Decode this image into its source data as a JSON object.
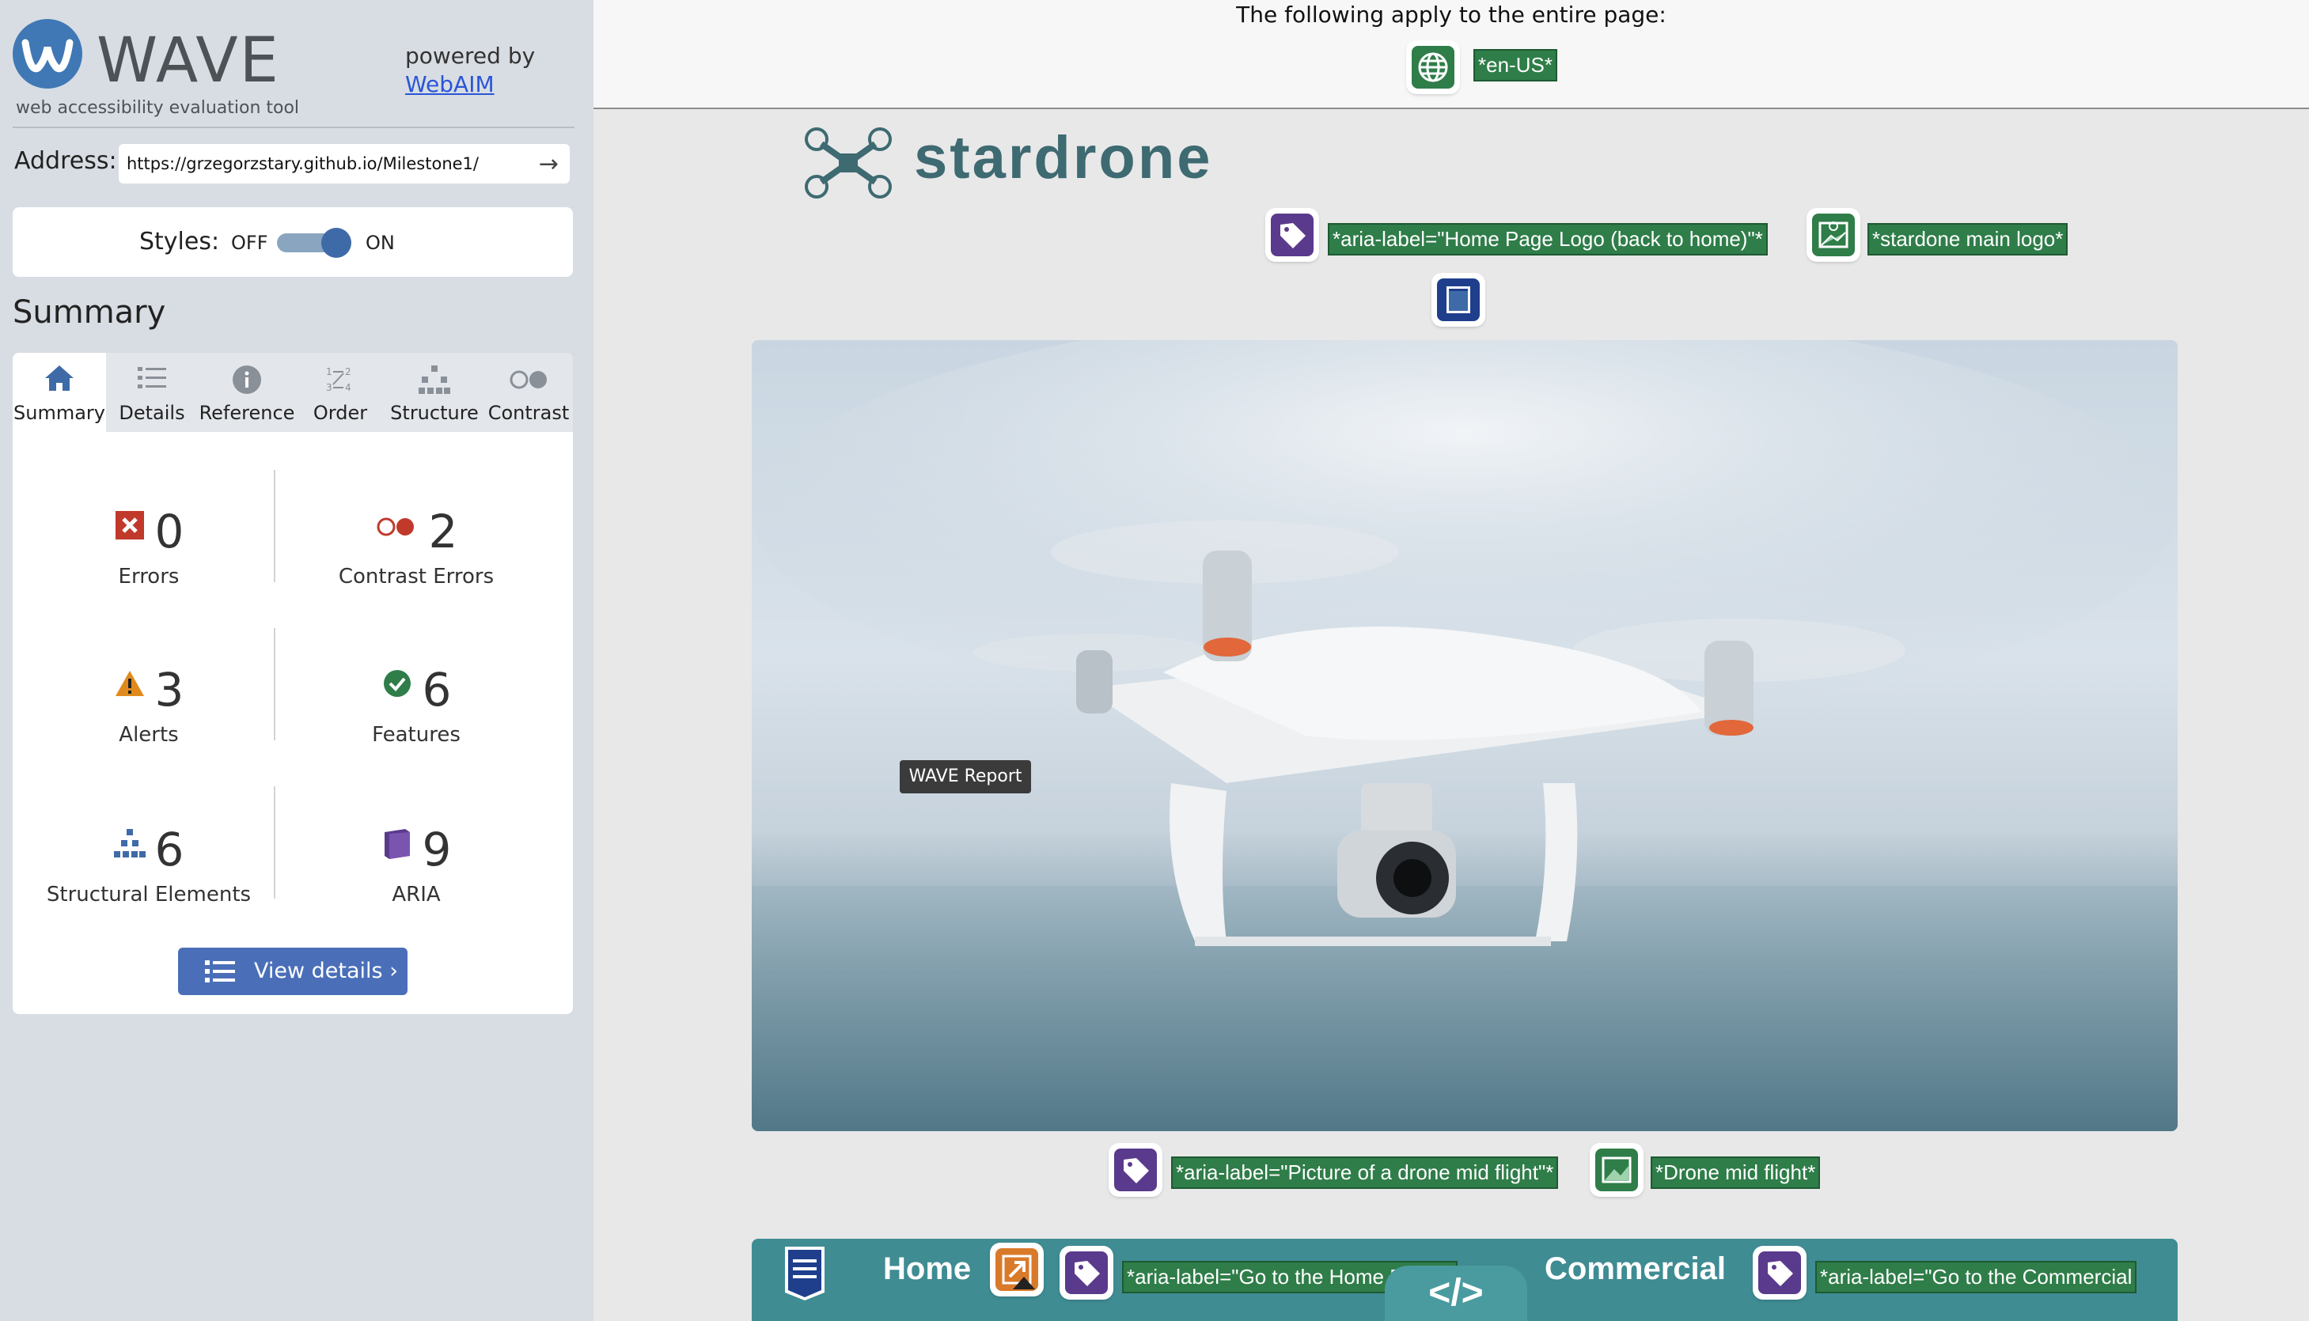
{
  "wave": {
    "logo_text": "WAVE",
    "logo_subtitle": "web accessibility evaluation tool",
    "powered_by": "powered by",
    "webaim_link": "WebAIM",
    "address_label": "Address:",
    "address_value": "https://grzegorzstary.github.io/Milestone1/",
    "styles_label": "Styles:",
    "styles_off": "OFF",
    "styles_on": "ON",
    "summary_heading": "Summary",
    "tabs": [
      {
        "label": "Summary",
        "icon": "home-icon",
        "active": true
      },
      {
        "label": "Details",
        "icon": "list-icon"
      },
      {
        "label": "Reference",
        "icon": "info-icon"
      },
      {
        "label": "Order",
        "icon": "order-icon"
      },
      {
        "label": "Structure",
        "icon": "structure-icon"
      },
      {
        "label": "Contrast",
        "icon": "contrast-icon"
      }
    ],
    "stats": {
      "errors": {
        "count": "0",
        "label": "Errors"
      },
      "contrast_errors": {
        "count": "2",
        "label": "Contrast Errors"
      },
      "alerts": {
        "count": "3",
        "label": "Alerts"
      },
      "features": {
        "count": "6",
        "label": "Features"
      },
      "structural": {
        "count": "6",
        "label": "Structural Elements"
      },
      "aria": {
        "count": "9",
        "label": "ARIA"
      }
    },
    "view_details": "View details ›"
  },
  "page": {
    "apply_text": "The following apply to the entire page:",
    "lang_tag": "*en-US*",
    "brand": "stardrone",
    "logo_aria_tag": "*aria-label=\"Home Page Logo (back to home)\"*",
    "logo_alt_tag": "*stardone main logo*",
    "tooltip": "WAVE Report",
    "image_aria_tag": "*aria-label=\"Picture of a drone mid flight\"*",
    "image_alt_tag": "*Drone mid flight*",
    "nav_home": "Home",
    "nav_home_tag": "*aria-label=\"Go to the Home Page\"*",
    "nav_commercial": "Commercial",
    "nav_commercial_tag": "*aria-label=\"Go to the Commercial",
    "code_toggle": "</>"
  },
  "colors": {
    "wave_blue": "#3f6aa8",
    "feature_green": "#2f7d49",
    "aria_purple": "#5a3a8c",
    "error_red": "#c0392b",
    "alert_orange": "#e08a1e",
    "nav_teal": "#3f8c93"
  }
}
